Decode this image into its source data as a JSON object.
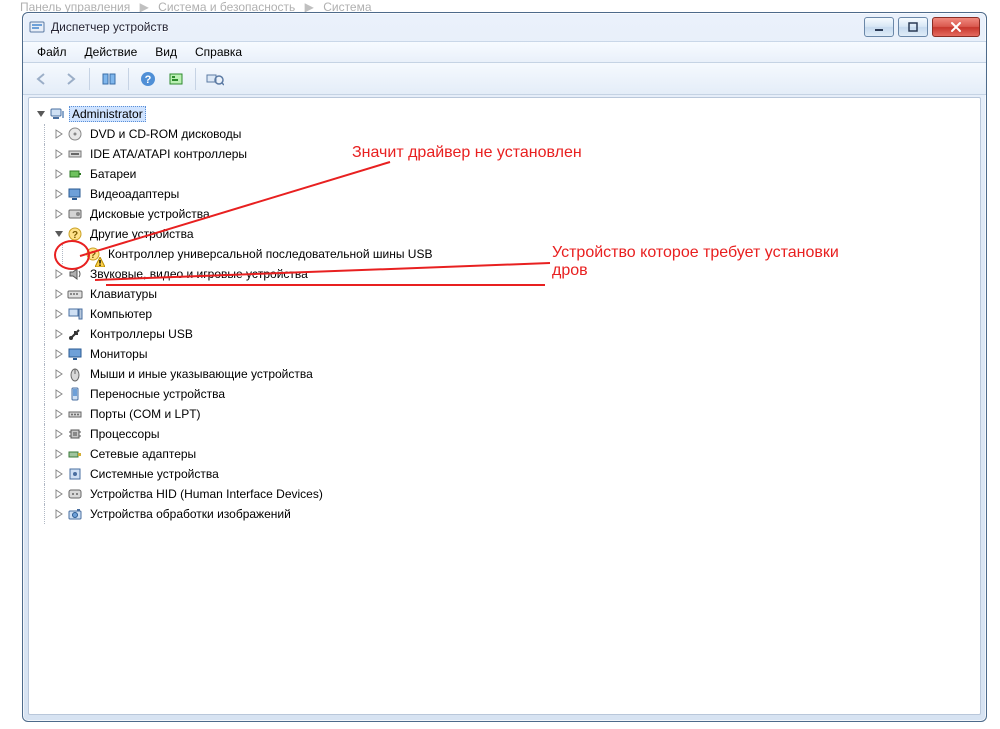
{
  "breadcrumb": {
    "segments": [
      "Панель управления",
      "Система и безопасность",
      "Система"
    ]
  },
  "window": {
    "title": "Диспетчер устройств"
  },
  "menu": {
    "items": [
      "Файл",
      "Действие",
      "Вид",
      "Справка"
    ]
  },
  "toolbar": {
    "buttons": [
      {
        "name": "back-button",
        "enabled": false,
        "icon": "arrow-left-icon"
      },
      {
        "name": "forward-button",
        "enabled": false,
        "icon": "arrow-right-icon"
      },
      {
        "sep": true
      },
      {
        "name": "show-hidden-button",
        "enabled": true,
        "icon": "columns-icon"
      },
      {
        "sep": true
      },
      {
        "name": "help-button",
        "enabled": true,
        "icon": "help-icon"
      },
      {
        "name": "details-button",
        "enabled": true,
        "icon": "green-box-icon"
      },
      {
        "sep": true
      },
      {
        "name": "scan-button",
        "enabled": true,
        "icon": "scan-icon"
      }
    ]
  },
  "tree": {
    "root": {
      "label": "Administrator",
      "icon": "computer-icon",
      "expanded": true,
      "selected": true
    },
    "children": [
      {
        "label": "DVD и CD-ROM дисководы",
        "icon": "optical-drive-icon"
      },
      {
        "label": "IDE ATA/ATAPI контроллеры",
        "icon": "ide-controller-icon"
      },
      {
        "label": "Батареи",
        "icon": "battery-icon"
      },
      {
        "label": "Видеоадаптеры",
        "icon": "display-adapter-icon"
      },
      {
        "label": "Дисковые устройства",
        "icon": "disk-drive-icon"
      },
      {
        "label": "Другие устройства",
        "icon": "unknown-device-icon",
        "expanded": true,
        "children": [
          {
            "label": "Контроллер универсальной последовательной шины USB",
            "icon": "unknown-device-icon",
            "warn": true
          }
        ]
      },
      {
        "label": "Звуковые, видео и игровые устройства",
        "icon": "speaker-icon"
      },
      {
        "label": "Клавиатуры",
        "icon": "keyboard-icon"
      },
      {
        "label": "Компьютер",
        "icon": "pc-icon"
      },
      {
        "label": "Контроллеры USB",
        "icon": "usb-icon"
      },
      {
        "label": "Мониторы",
        "icon": "monitor-icon"
      },
      {
        "label": "Мыши и иные указывающие устройства",
        "icon": "mouse-icon"
      },
      {
        "label": "Переносные устройства",
        "icon": "portable-device-icon"
      },
      {
        "label": "Порты (COM и LPT)",
        "icon": "port-icon"
      },
      {
        "label": "Процессоры",
        "icon": "cpu-icon"
      },
      {
        "label": "Сетевые адаптеры",
        "icon": "network-adapter-icon"
      },
      {
        "label": "Системные устройства",
        "icon": "system-device-icon"
      },
      {
        "label": "Устройства HID (Human Interface Devices)",
        "icon": "hid-icon"
      },
      {
        "label": "Устройства обработки изображений",
        "icon": "imaging-device-icon"
      }
    ]
  },
  "annotations": {
    "note1": "Значит драйвер не установлен",
    "note2": "Устройство которое требует установки дров"
  }
}
